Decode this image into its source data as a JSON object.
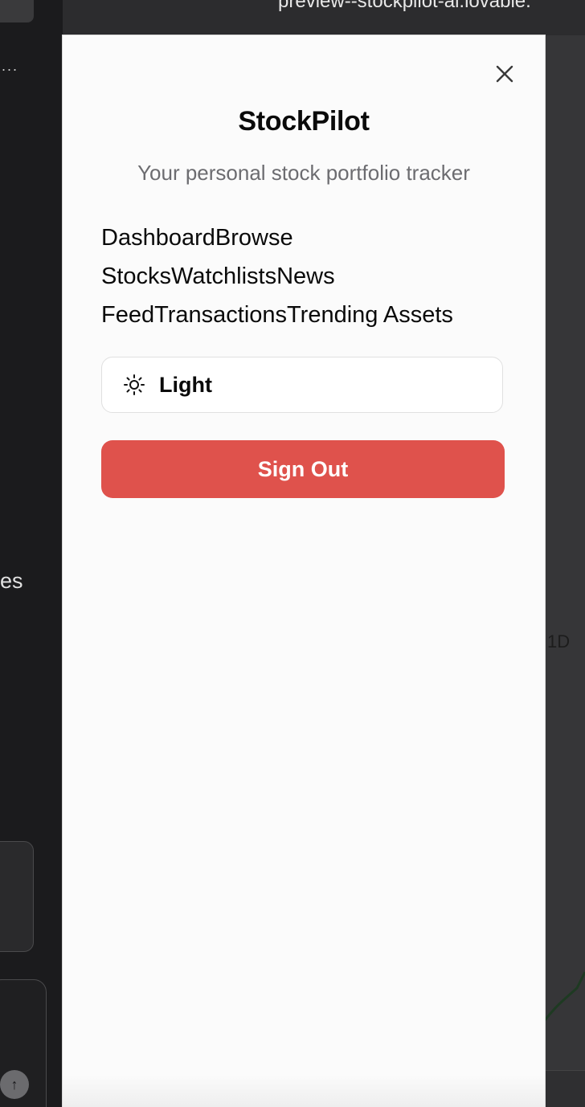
{
  "browser": {
    "url": "preview--stockpilot-ai.lovable."
  },
  "editor": {
    "more_label": "...",
    "partial_text": "es",
    "send_icon": "arrow-up-icon"
  },
  "underlying_app": {
    "timeframe_label": "1D"
  },
  "drawer": {
    "title": "StockPilot",
    "subtitle": "Your personal stock portfolio tracker",
    "close_icon": "close-icon",
    "nav_links": [
      {
        "label": "Dashboard"
      },
      {
        "label": "Browse Stocks"
      },
      {
        "label": "Watchlists"
      },
      {
        "label": "News Feed"
      },
      {
        "label": "Transactions"
      },
      {
        "label": "Trending Assets"
      }
    ],
    "theme_toggle": {
      "label": "Light",
      "icon": "sun-icon"
    },
    "sign_out_label": "Sign Out",
    "colors": {
      "sign_out_bg": "#df524c",
      "drawer_bg": "#fbfbfb",
      "subtitle": "#6c6c70"
    }
  }
}
